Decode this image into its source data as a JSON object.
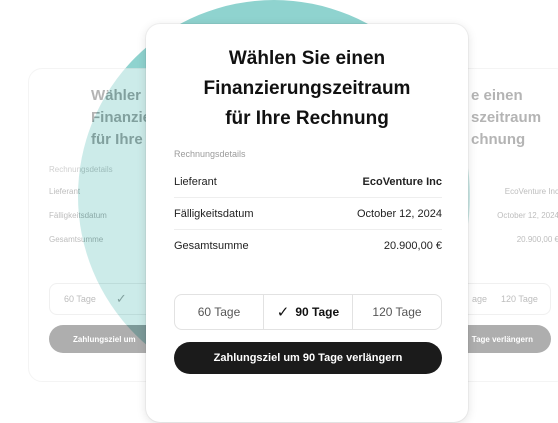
{
  "dialog": {
    "title_lines": [
      "Wählen Sie einen",
      "Finanzierungszeitraum",
      "für Ihre Rechnung"
    ],
    "section_label": "Rechnungsdetails",
    "rows": [
      {
        "label": "Lieferant",
        "value": "EcoVenture Inc"
      },
      {
        "label": "Fälligkeitsdatum",
        "value": "October 12, 2024"
      },
      {
        "label": "Gesamtsumme",
        "value": "20.900,00 €"
      }
    ],
    "options": [
      {
        "label": "60 Tage",
        "selected": false
      },
      {
        "label": "90 Tage",
        "selected": true,
        "icon": "check-icon"
      },
      {
        "label": "120 Tage",
        "selected": false
      }
    ],
    "cta_label": "Zahlungsziel um 90 Tage verlängern"
  },
  "ghost_left": {
    "title_lines": [
      "Wähler",
      "Finanzieru",
      "für Ihre"
    ],
    "section_label": "Rechnungsdetails",
    "rows": [
      "Lieferant",
      "Fälligkeitsdatum",
      "Gesamtsumme"
    ],
    "option_label": "60 Tage",
    "option_icon": "check-icon",
    "cta_label": "Zahlungsziel um"
  },
  "ghost_right": {
    "title_lines": [
      "e einen",
      "szeitraum",
      "chnung"
    ],
    "values": [
      "EcoVenture Inc",
      "October 12, 2024",
      "20.900,00 €"
    ],
    "option_label": "120 Tage",
    "option_partial": "age",
    "cta_label": "Tage verlängern"
  },
  "colors": {
    "accent_circle": "#8fd3cf",
    "button": "#1b1b1b"
  }
}
